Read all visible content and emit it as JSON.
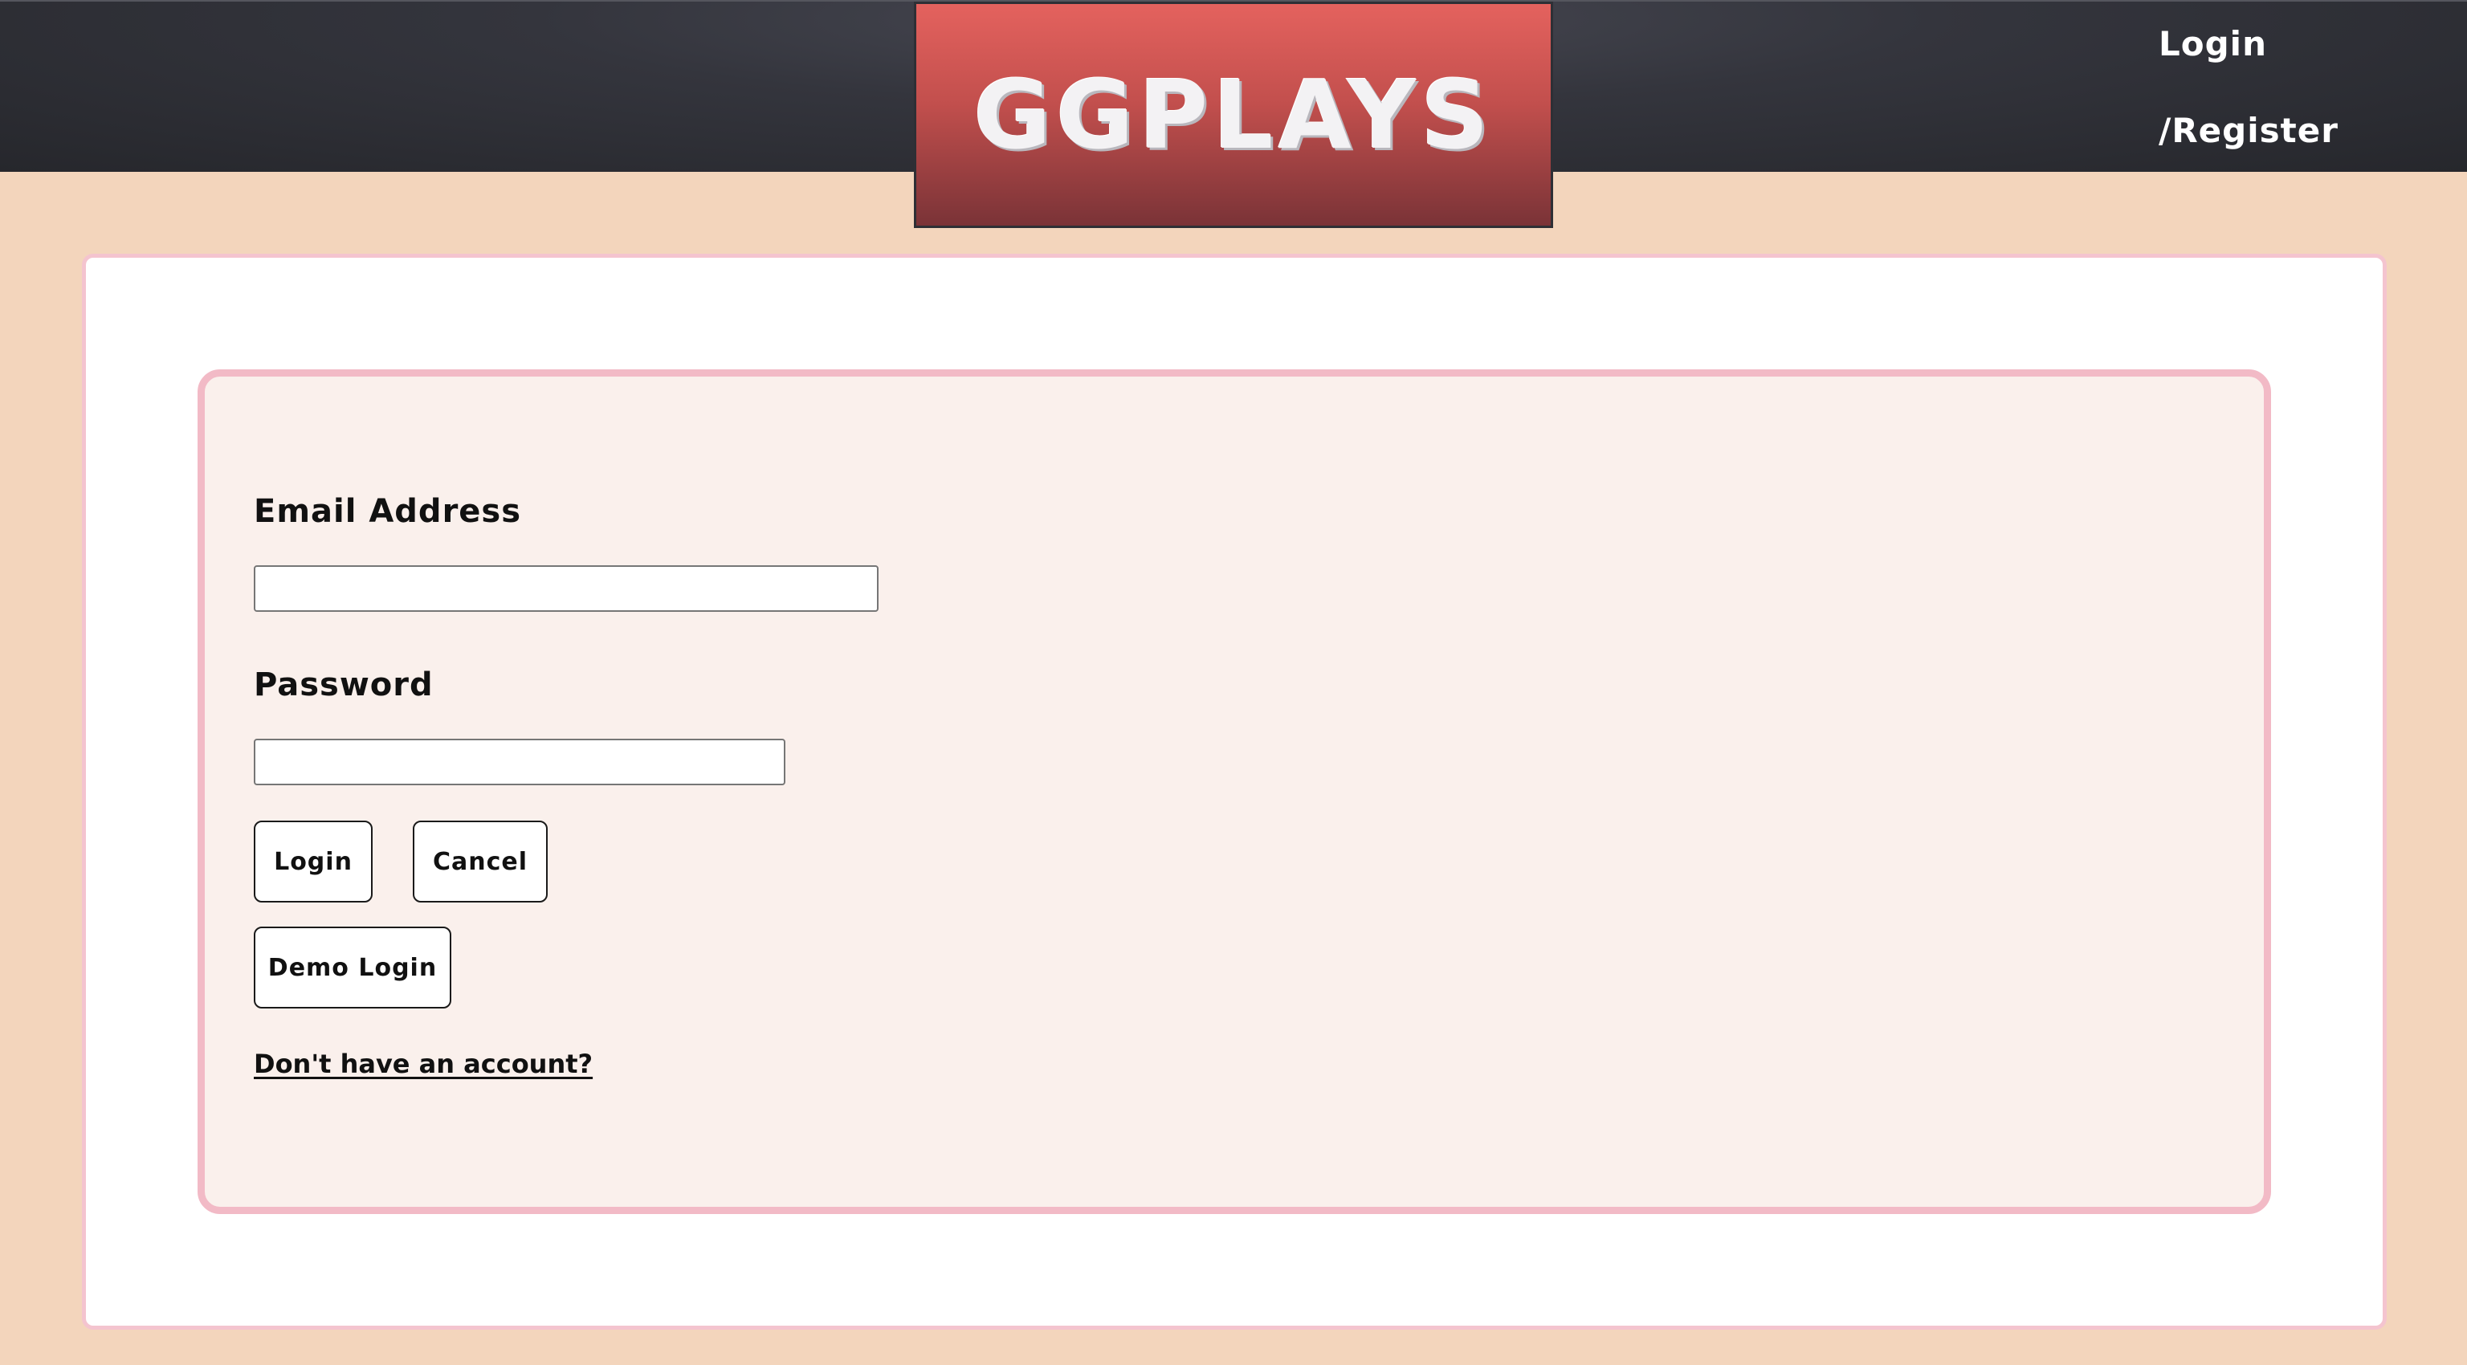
{
  "header": {
    "logo_text": "GGPLAYS",
    "nav_login": "Login",
    "nav_register": "/Register"
  },
  "form": {
    "email_label": "Email Address",
    "email_value": "",
    "email_placeholder": "",
    "password_label": "Password",
    "password_value": "",
    "password_placeholder": "",
    "login_button": "Login",
    "cancel_button": "Cancel",
    "demo_login_button": "Demo Login",
    "signup_link": "Don't have an account?"
  },
  "colors": {
    "page_background": "#f3d5bc",
    "header_background": "#2b2c32",
    "logo_background": "#c24f4d",
    "card_border": "#f4c4cf",
    "panel_background": "#faf0ec"
  }
}
